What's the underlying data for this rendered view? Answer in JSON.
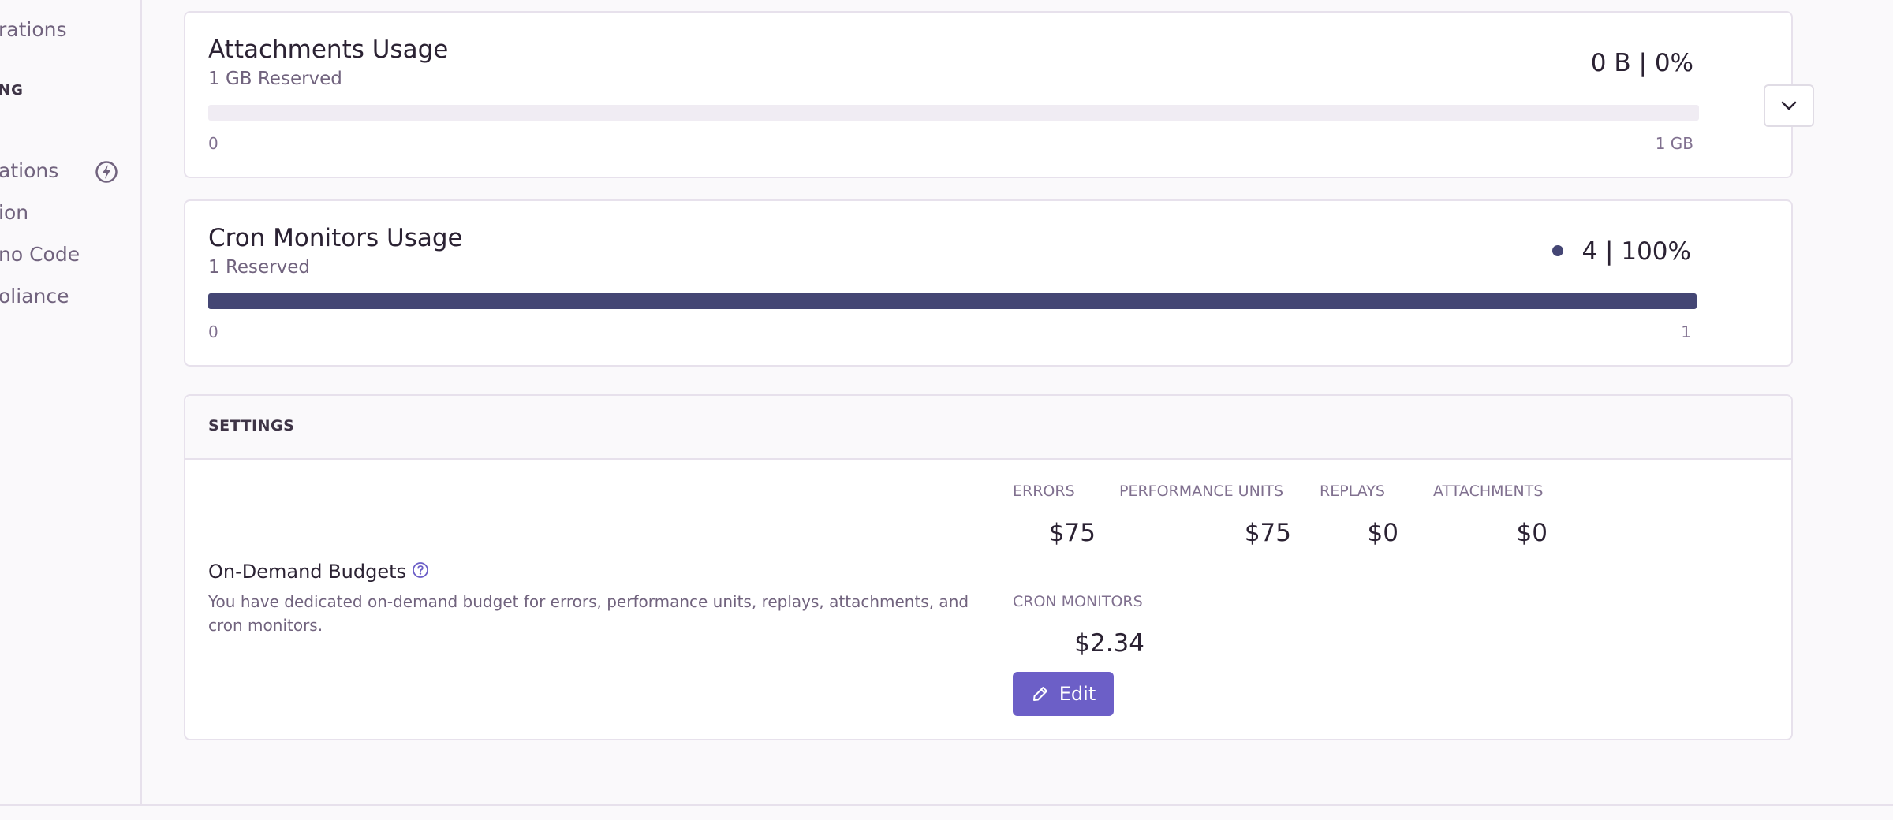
{
  "sidebar": {
    "items": [
      {
        "label": "rations"
      },
      {
        "label": "ations"
      },
      {
        "label": "ion"
      },
      {
        "label": "no Code"
      },
      {
        "label": "oliance"
      }
    ],
    "section_heading": "NG",
    "icon": "lightning-bolt-icon"
  },
  "attachments": {
    "title": "Attachments Usage",
    "subtitle": "1 GB Reserved",
    "usage": "0 B",
    "separator": "|",
    "percent": "0%",
    "fill_fraction": 0,
    "tick_min": "0",
    "tick_max": "1 GB",
    "expand_icon": "chevron-down-icon"
  },
  "cron": {
    "title": "Cron Monitors Usage",
    "subtitle": "1 Reserved",
    "usage": "4",
    "separator": "|",
    "percent": "100%",
    "fill_fraction": 1,
    "tick_min": "0",
    "tick_max": "1"
  },
  "settings": {
    "header": "SETTINGS",
    "budget_title": "On-Demand Budgets",
    "budget_description": "You have dedicated on-demand budget for errors, performance units, replays, attachments, and cron monitors.",
    "categories": [
      {
        "label": "ERRORS",
        "value": "$75"
      },
      {
        "label": "PERFORMANCE UNITS",
        "value": "$75"
      },
      {
        "label": "REPLAYS",
        "value": "$0"
      },
      {
        "label": "ATTACHMENTS",
        "value": "$0"
      },
      {
        "label": "CRON MONITORS",
        "value": "$2.34"
      }
    ],
    "edit_label": "Edit"
  },
  "colors": {
    "accent": "#6c5fc7",
    "bar_fill": "#444674",
    "bar_track": "#f0ecf3"
  }
}
